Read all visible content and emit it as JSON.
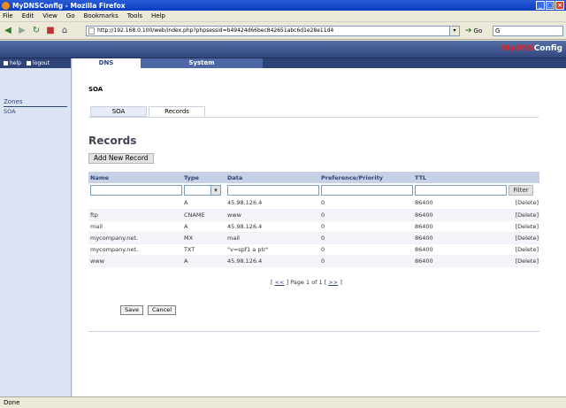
{
  "window": {
    "title": "MyDNSConfig - Mozilla Firefox"
  },
  "menu": [
    "File",
    "Edit",
    "View",
    "Go",
    "Bookmarks",
    "Tools",
    "Help"
  ],
  "nav": {
    "url": "http://192.168.0.100/web/index.php?phpsessid=b49424d66bec842651abc6d1e28e11d4",
    "go_label": "Go",
    "search_value": "G"
  },
  "brand": {
    "prefix": "MyDNS",
    "suffix": "Config"
  },
  "sidebar": {
    "help": "help",
    "logout": "logout",
    "zones_title": "Zones",
    "zones_item": "SOA"
  },
  "topnav": {
    "dns": "DNS",
    "system": "System"
  },
  "page": {
    "soa_heading": "SOA",
    "subtabs": [
      "SOA",
      "Records"
    ],
    "records_title": "Records",
    "add_button": "Add New Record"
  },
  "table": {
    "headers": [
      "Name",
      "Type",
      "Data",
      "Preference/Priority",
      "TTL"
    ],
    "filter_button": "Filter",
    "delete_label": "[Delete]",
    "rows": [
      [
        "",
        "A",
        "45.98.126.4",
        "0",
        "86400"
      ],
      [
        "ftp",
        "CNAME",
        "www",
        "0",
        "86400"
      ],
      [
        "mail",
        "A",
        "45.98.126.4",
        "0",
        "86400"
      ],
      [
        "mycompany.net.",
        "MX",
        "mail",
        "0",
        "86400"
      ],
      [
        "mycompany.net.",
        "TXT",
        "\"v=spf1 a ptr\"",
        "0",
        "86400"
      ],
      [
        "www",
        "A",
        "45.98.126.4",
        "0",
        "86400"
      ]
    ]
  },
  "pager": {
    "first": "<<",
    "text": "Page 1 of 1",
    "last": ">>"
  },
  "buttons": {
    "save": "Save",
    "cancel": "Cancel"
  },
  "status": "Done",
  "colors": {
    "accent": "#2e4478",
    "brand_red": "#e0242a",
    "header_row": "#c7d1e6"
  }
}
